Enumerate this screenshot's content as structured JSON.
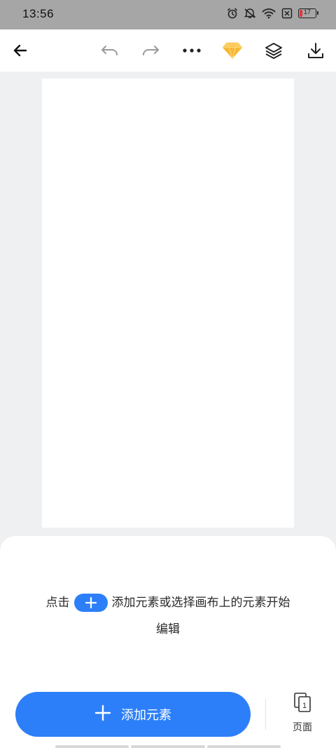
{
  "status_bar": {
    "time": "13:56",
    "battery_level": "17",
    "battery_color": "#e0383e"
  },
  "toolbar": {
    "icons": [
      "back-arrow-icon",
      "undo-icon",
      "redo-icon",
      "more-icon",
      "vip-diamond-icon",
      "layers-icon",
      "download-icon"
    ],
    "diamond_color": "#f7b733"
  },
  "canvas": {
    "page_color": "#ffffff",
    "background_color": "#eff0f2"
  },
  "bottom_sheet": {
    "hint_prefix": "点击",
    "hint_suffix": "添加元素或选择画布上的元素开始",
    "hint_line2": "编辑",
    "add_button_label": "添加元素",
    "pages_label": "页面",
    "pages_count": "1",
    "accent_color": "#2d7ff9"
  }
}
